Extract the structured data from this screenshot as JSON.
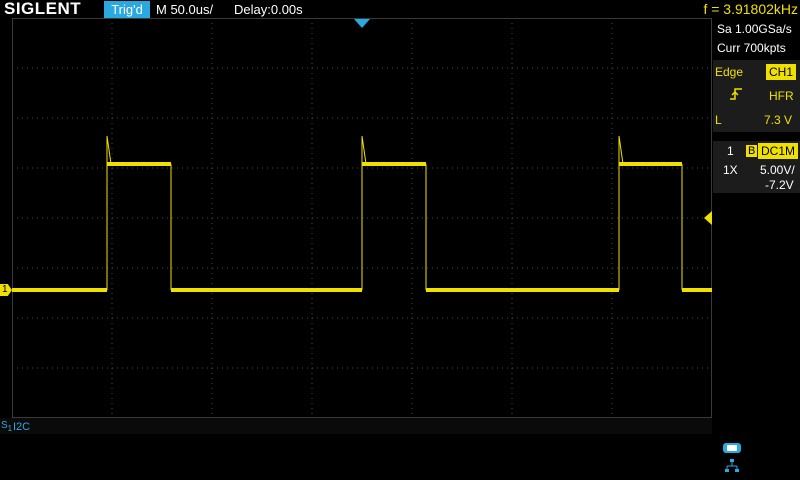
{
  "header": {
    "brand": "SIGLENT",
    "trigger_status": "Trig'd",
    "timebase": "M 50.0us/",
    "delay": "Delay:0.00s",
    "frequency": "f = 3.91802kHz"
  },
  "acquisition": {
    "sample_rate": "Sa 1.00GSa/s",
    "memory_depth": "Curr 700kpts"
  },
  "trigger": {
    "type_label": "Edge",
    "source": "CH1",
    "coupling": "HFR",
    "level_label": "L",
    "level_value": "7.3 V",
    "slope_icon": "rising-edge-icon"
  },
  "channel1": {
    "number": "1",
    "bw_badge": "B",
    "coupling": "DC1M",
    "probe": "1X",
    "volts_per_div": "5.00V/",
    "offset": "-7.2V",
    "marker_label": "1",
    "color": "#f0e000"
  },
  "bus": {
    "slot_label": "S",
    "slot_index": "1",
    "protocol": "I2C"
  },
  "colors": {
    "trace": "#f0e000",
    "accent": "#2aa8e0",
    "grid": "#555555"
  },
  "status_icons": [
    "usb-icon",
    "network-icon"
  ]
}
